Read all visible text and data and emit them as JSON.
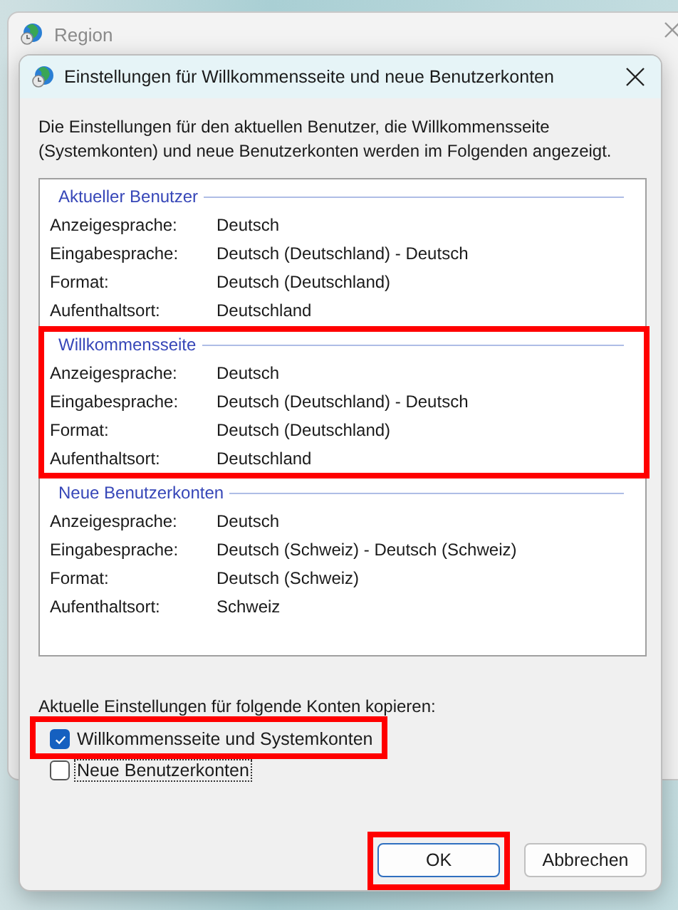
{
  "background_window": {
    "title": "Region"
  },
  "dialog": {
    "title": "Einstellungen für Willkommensseite und neue Benutzerkonten",
    "intro": "Die Einstellungen für den aktuellen Benutzer, die Willkommensseite (Systemkonten) und neue Benutzerkonten werden im Folgenden angezeigt.",
    "sections": [
      {
        "title": "Aktueller Benutzer",
        "highlighted": false,
        "rows": [
          {
            "label": "Anzeigesprache:",
            "value": "Deutsch"
          },
          {
            "label": "Eingabesprache:",
            "value": "Deutsch (Deutschland) - Deutsch"
          },
          {
            "label": "Format:",
            "value": "Deutsch (Deutschland)"
          },
          {
            "label": "Aufenthaltsort:",
            "value": "Deutschland"
          }
        ]
      },
      {
        "title": "Willkommensseite",
        "highlighted": true,
        "rows": [
          {
            "label": "Anzeigesprache:",
            "value": "Deutsch"
          },
          {
            "label": "Eingabesprache:",
            "value": "Deutsch (Deutschland) - Deutsch"
          },
          {
            "label": "Format:",
            "value": "Deutsch (Deutschland)"
          },
          {
            "label": "Aufenthaltsort:",
            "value": "Deutschland"
          }
        ]
      },
      {
        "title": "Neue Benutzerkonten",
        "highlighted": false,
        "rows": [
          {
            "label": "Anzeigesprache:",
            "value": "Deutsch"
          },
          {
            "label": "Eingabesprache:",
            "value": "Deutsch (Schweiz) - Deutsch (Schweiz)"
          },
          {
            "label": "Format:",
            "value": "Deutsch (Schweiz)"
          },
          {
            "label": "Aufenthaltsort:",
            "value": "Schweiz"
          }
        ]
      }
    ],
    "copy_label": "Aktuelle Einstellungen für folgende Konten kopieren:",
    "options": [
      {
        "label": "Willkommensseite und Systemkonten",
        "checked": true,
        "focused": false,
        "highlighted": true
      },
      {
        "label": "Neue Benutzerkonten",
        "checked": false,
        "focused": true,
        "highlighted": false
      }
    ],
    "buttons": [
      {
        "label": "OK",
        "default": true,
        "highlighted": true
      },
      {
        "label": "Abbrechen",
        "default": false,
        "highlighted": false
      }
    ]
  }
}
